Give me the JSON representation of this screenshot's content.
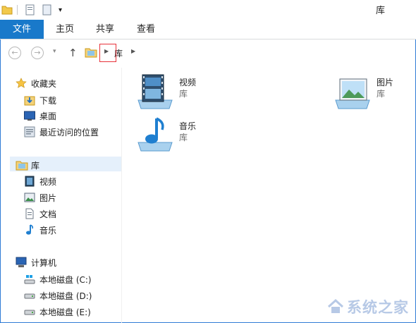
{
  "window": {
    "title": "库"
  },
  "ribbon": {
    "tabs": [
      "文件",
      "主页",
      "共享",
      "查看"
    ]
  },
  "address": {
    "path": [
      "库"
    ]
  },
  "nav": {
    "favorites": {
      "label": "收藏夹",
      "items": [
        "下载",
        "桌面",
        "最近访问的位置"
      ]
    },
    "libraries": {
      "label": "库",
      "items": [
        "视频",
        "图片",
        "文档",
        "音乐"
      ]
    },
    "computer": {
      "label": "计算机",
      "items": [
        "本地磁盘 (C:)",
        "本地磁盘 (D:)",
        "本地磁盘 (E:)"
      ]
    }
  },
  "content": {
    "libraries": [
      {
        "name": "视频",
        "type": "库"
      },
      {
        "name": "图片",
        "type": "库"
      },
      {
        "name": "音乐",
        "type": "库"
      }
    ]
  },
  "watermark": {
    "text": "系统之家"
  },
  "colors": {
    "accent": "#1979ca",
    "selection": "#e5f0fb",
    "highlight": "#e8323a"
  }
}
